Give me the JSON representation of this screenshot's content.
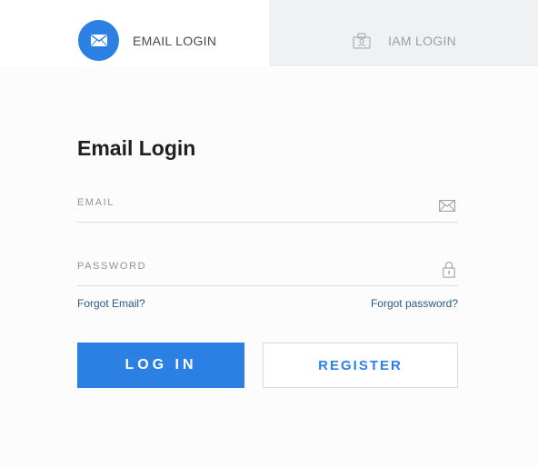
{
  "tabs": {
    "email": {
      "label": "EMAIL LOGIN",
      "icon": "envelope-icon",
      "active": true
    },
    "iam": {
      "label": "IAM LOGIN",
      "icon": "id-card-icon",
      "active": false
    }
  },
  "form": {
    "title": "Email Login",
    "email": {
      "label": "EMAIL",
      "value": "",
      "icon": "envelope-icon"
    },
    "password": {
      "label": "PASSWORD",
      "value": "",
      "icon": "lock-icon"
    },
    "forgot_email": "Forgot Email?",
    "forgot_password": "Forgot password?",
    "login_label": "LOG IN",
    "register_label": "REGISTER"
  },
  "colors": {
    "accent": "#2c80e3",
    "tab_inactive_bg": "#eff1f2",
    "link": "#2a5a86"
  }
}
